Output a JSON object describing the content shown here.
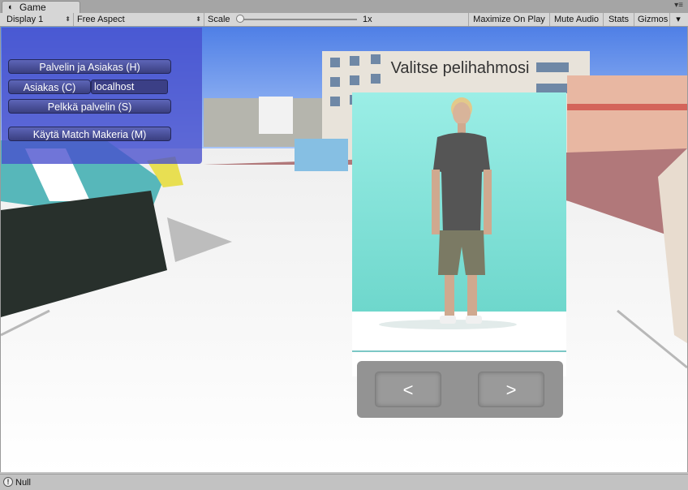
{
  "window": {
    "tab_label": "Game",
    "tab_icon": "unity-logo-icon",
    "menu_glyph": "▾≡"
  },
  "toolbar": {
    "display": "Display 1",
    "aspect": "Free Aspect",
    "scale_label": "Scale",
    "scale_value": "1x",
    "scale_fraction": 0.0,
    "maximize": "Maximize On Play",
    "mute": "Mute Audio",
    "stats": "Stats",
    "gizmos": "Gizmos",
    "dropdown_glyph": "▾",
    "updown_glyph": "⬍"
  },
  "network_menu": {
    "host_button": "Palvelin ja Asiakas (H)",
    "client_button": "Asiakas (C)",
    "address_value": "localhost",
    "server_button": "Pelkkä palvelin (S)",
    "matchmaker_button": "Käytä Match Makeria (M)"
  },
  "character_select": {
    "title": "Valitse pelihahmosi",
    "prev_label": "<",
    "next_label": ">"
  },
  "status": {
    "icon": "info-icon",
    "text": "Null"
  },
  "colors": {
    "panel_blue": "#4a50d0",
    "character_bg": "#8ae6dd",
    "nav_gray": "#939393"
  }
}
